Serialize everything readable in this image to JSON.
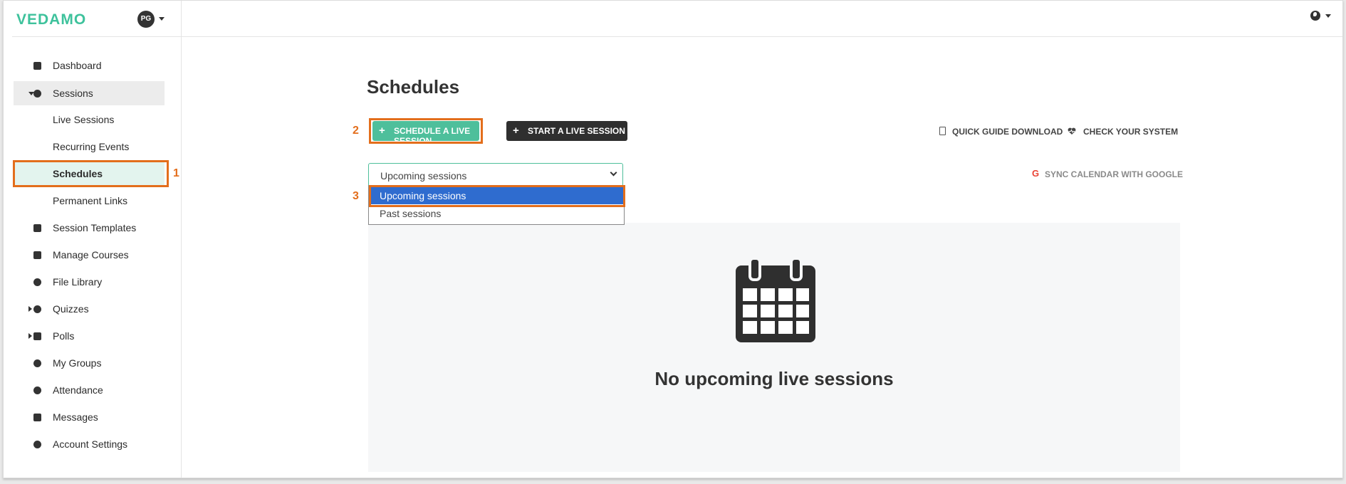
{
  "brand": {
    "logo_text": "VEDAMO",
    "avatar_initials": "PG",
    "accent_color": "#3ec29c"
  },
  "sidebar": {
    "items": [
      {
        "label": "Dashboard",
        "icon": "dashboard-icon"
      },
      {
        "label": "Sessions",
        "icon": "play-circle-icon",
        "expanded": true
      },
      {
        "label": "Live Sessions"
      },
      {
        "label": "Recurring Events"
      },
      {
        "label": "Schedules",
        "active": true
      },
      {
        "label": "Permanent Links"
      },
      {
        "label": "Session Templates",
        "icon": "template-icon"
      },
      {
        "label": "Manage Courses",
        "icon": "book-icon"
      },
      {
        "label": "File Library",
        "icon": "cloud-icon"
      },
      {
        "label": "Quizzes",
        "icon": "question-icon"
      },
      {
        "label": "Polls",
        "icon": "chart-icon"
      },
      {
        "label": "My Groups",
        "icon": "group-icon"
      },
      {
        "label": "Attendance",
        "icon": "attendance-icon"
      },
      {
        "label": "Messages",
        "icon": "envelope-icon"
      },
      {
        "label": "Account Settings",
        "icon": "gear-icon"
      }
    ]
  },
  "annotations": {
    "step1": "1",
    "step2": "2",
    "step3": "3",
    "highlight_color": "#e36e1c"
  },
  "main": {
    "title": "Schedules",
    "schedule_button": "SCHEDULE A LIVE SESSION",
    "start_button": "START A LIVE SESSION",
    "quick_guide": "QUICK GUIDE DOWNLOAD",
    "check_system": "CHECK YOUR SYSTEM",
    "sync_calendar": "SYNC CALENDAR WITH GOOGLE",
    "filter": {
      "selected": "Upcoming sessions",
      "options": [
        "Upcoming sessions",
        "Past sessions"
      ]
    },
    "empty_message": "No upcoming live sessions"
  }
}
